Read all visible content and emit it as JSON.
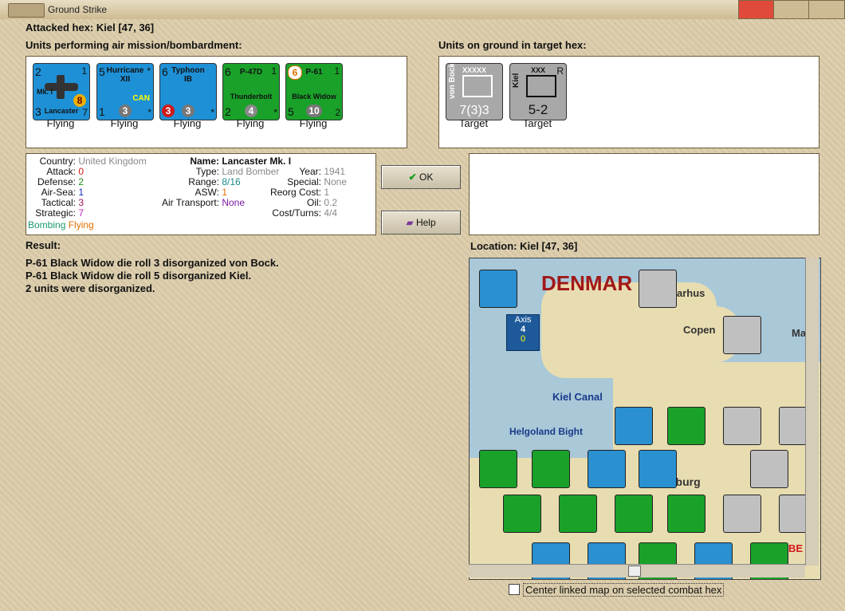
{
  "window": {
    "title": "Ground Strike"
  },
  "header": {
    "attacked_hex": "Attacked hex: Kiel  [47, 36]"
  },
  "air_panel": {
    "label": "Units performing air mission/bombardment:",
    "units": [
      {
        "name": "Mk. I",
        "sub": "Lancaster",
        "top": "2",
        "topr": "1",
        "botl": "3",
        "botr": "7",
        "circle": "8",
        "status": "Flying",
        "color": "#1e90d6"
      },
      {
        "name": "Hurricane",
        "sub": "XII",
        "extra": "CAN",
        "top": "5",
        "topr": "*",
        "botl": "1",
        "botr": "*",
        "circle": "3",
        "status": "Flying",
        "color": "#1e90d6"
      },
      {
        "name": "Typhoon",
        "sub": "IB",
        "top": "6",
        "topr": "",
        "botl": "3",
        "botr": "*",
        "circle": "3",
        "status": "Flying",
        "color": "#1e90d6"
      },
      {
        "name": "P-47D",
        "sub": "Thunderbolt",
        "top": "6",
        "topr": "1",
        "botl": "2",
        "botr": "*",
        "circle": "4",
        "status": "Flying",
        "color": "#1aa12a"
      },
      {
        "name": "P-61",
        "sub": "Black Widow",
        "top": "6",
        "topr": "1",
        "botl": "5",
        "botr": "2",
        "circle": "10",
        "status": "Flying",
        "color": "#1aa12a"
      }
    ]
  },
  "ground_panel": {
    "label": "Units on ground in target hex:",
    "units": [
      {
        "name": "von Bock",
        "size": "XXXXX",
        "value": "7(3)3",
        "status": "Target"
      },
      {
        "name": "Kiel",
        "size": "XXX",
        "extra": "R",
        "value": "5-2",
        "status": "Target"
      }
    ]
  },
  "info": {
    "country_k": "Country:",
    "country_v": "United Kingdom",
    "attack_k": "Attack:",
    "attack_v": "0",
    "defense_k": "Defense:",
    "defense_v": "2",
    "airsea_k": "Air-Sea:",
    "airsea_v": "1",
    "tactical_k": "Tactical:",
    "tactical_v": "3",
    "strategic_k": "Strategic:",
    "strategic_v": "7",
    "bombing": "Bombing",
    "flying": "Flying",
    "name_k": "Name:",
    "name_v": "Lancaster Mk. I",
    "type_k": "Type:",
    "type_v": "Land Bomber",
    "range_k": "Range:",
    "range_v": "8/16",
    "asw_k": "ASW:",
    "asw_v": "1",
    "airtransport_k": "Air Transport:",
    "airtransport_v": "None",
    "year_k": "Year:",
    "year_v": "1941",
    "special_k": "Special:",
    "special_v": "None",
    "reorg_k": "Reorg Cost:",
    "reorg_v": "1",
    "oil_k": "Oil:",
    "oil_v": "0.2",
    "cost_k": "Cost/Turns:",
    "cost_v": "4/4"
  },
  "buttons": {
    "ok": "OK",
    "help": "Help"
  },
  "result": {
    "label": "Result:",
    "lines": [
      "P-61 Black Widow die roll 3 disorganized von Bock.",
      "P-61 Black Widow die roll 5 disorganized Kiel.",
      "2 units were disorganized."
    ]
  },
  "location": {
    "label": "Location:  Kiel  [47, 36]"
  },
  "map": {
    "labels": {
      "denmark": "DENMAR",
      "arhus": "arhus",
      "copen": "Copen",
      "kiel_canal": "Kiel Canal",
      "helgoland": "Helgoland Bight",
      "axis": "Axis",
      "axis_num": "4",
      "axis_num2": "0",
      "burg": "nburg",
      "ma": "Ma",
      "be": "BE"
    }
  },
  "footer": {
    "center_map": "Center linked map on selected combat hex"
  }
}
